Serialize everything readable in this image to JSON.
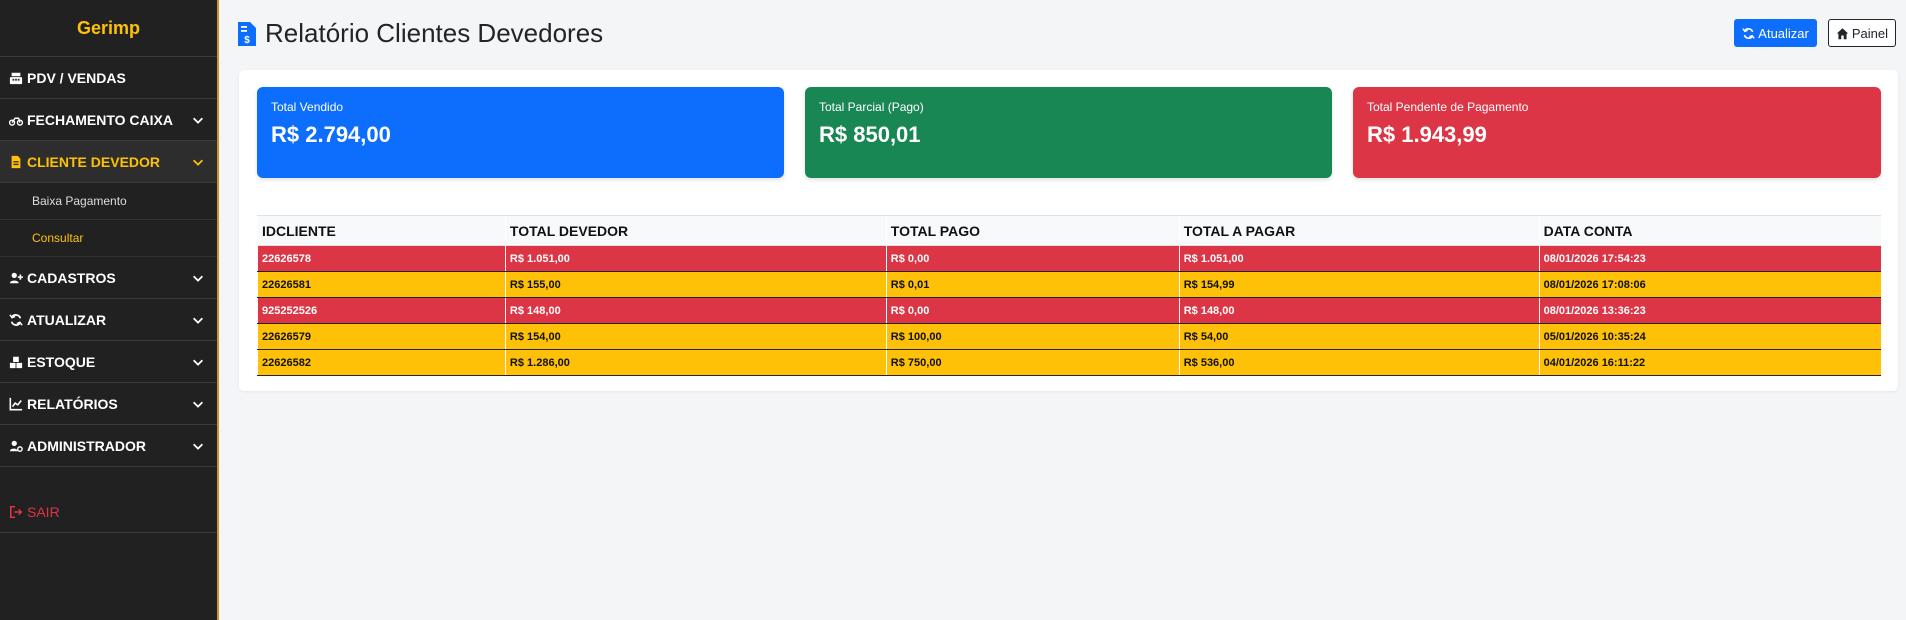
{
  "sidebar": {
    "brand": "Gerimp",
    "items": {
      "pdv": "PDV / VENDAS",
      "fechamento": "FECHAMENTO CAIXA",
      "cliente_devedor": "CLIENTE DEVEDOR",
      "cadastros": "CADASTROS",
      "atualizar": "ATUALIZAR",
      "estoque": "ESTOQUE",
      "relatorios": "RELATÓRIOS",
      "administrador": "ADMINISTRADOR"
    },
    "sub_items": {
      "baixa": "Baixa Pagamento",
      "consultar": "Consultar"
    },
    "sair": "SAIR"
  },
  "header": {
    "title": "Relatório Clientes Devedores",
    "atualizar": "Atualizar",
    "painel": "Painel"
  },
  "cards": {
    "vendido": {
      "title": "Total Vendido",
      "value": "R$ 2.794,00"
    },
    "parcial": {
      "title": "Total Parcial (Pago)",
      "value": "R$ 850,01"
    },
    "pendente": {
      "title": "Total Pendente de Pagamento",
      "value": "R$ 1.943,99"
    }
  },
  "table": {
    "headers": [
      "IDCLIENTE",
      "TOTAL DEVEDOR",
      "TOTAL PAGO",
      "TOTAL A PAGAR",
      "DATA CONTA"
    ],
    "rows": [
      {
        "status": "red",
        "cells": [
          "22626578",
          "R$ 1.051,00",
          "R$ 0,00",
          "R$ 1.051,00",
          "08/01/2026 17:54:23"
        ]
      },
      {
        "status": "yellow",
        "cells": [
          "22626581",
          "R$ 155,00",
          "R$ 0,01",
          "R$ 154,99",
          "08/01/2026 17:08:06"
        ]
      },
      {
        "status": "red",
        "cells": [
          "925252526",
          "R$ 148,00",
          "R$ 0,00",
          "R$ 148,00",
          "08/01/2026 13:36:23"
        ]
      },
      {
        "status": "yellow",
        "cells": [
          "22626579",
          "R$ 154,00",
          "R$ 100,00",
          "R$ 54,00",
          "05/01/2026 10:35:24"
        ]
      },
      {
        "status": "yellow",
        "cells": [
          "22626582",
          "R$ 1.286,00",
          "R$ 750,00",
          "R$ 536,00",
          "04/01/2026 16:11:22"
        ]
      }
    ]
  },
  "colors": {
    "accent": "#ffc107",
    "primary": "#0d6efd",
    "success": "#198754",
    "danger": "#dc3545",
    "sidebar_bg": "#212121"
  }
}
